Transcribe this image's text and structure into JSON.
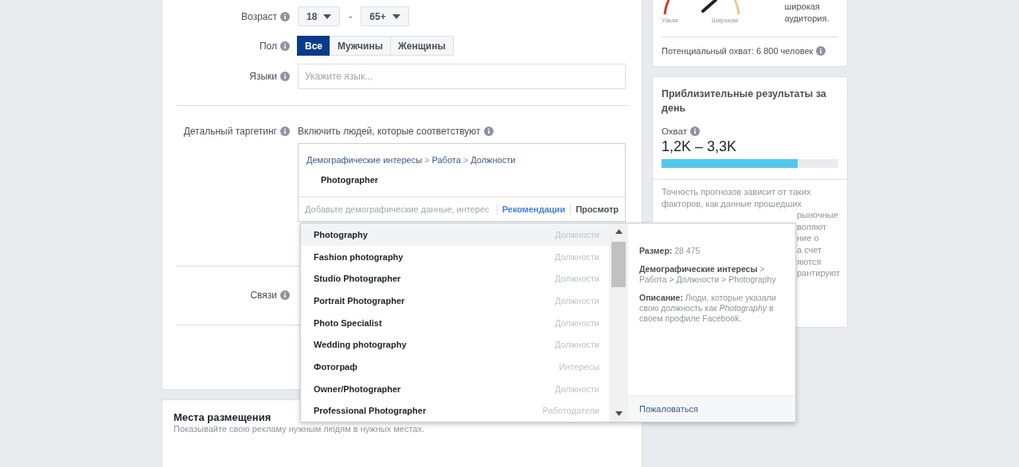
{
  "age": {
    "label": "Возраст",
    "from": "18",
    "separator": "-",
    "to": "65+"
  },
  "gender": {
    "label": "Пол",
    "options": [
      {
        "label": "Все",
        "selected": true
      },
      {
        "label": "Мужчины",
        "selected": false
      },
      {
        "label": "Женщины",
        "selected": false
      }
    ]
  },
  "languages": {
    "label": "Языки",
    "placeholder": "Укажите язык..."
  },
  "detailed_targeting": {
    "label": "Детальный таргетинг",
    "include_text": "Включить людей, которые соответствуют",
    "breadcrumb": [
      "Демографические интересы",
      "Работа",
      "Должности"
    ],
    "separator": ">",
    "selected_item": "Photographer",
    "search_placeholder": "Добавьте демографические данные, интерес",
    "suggestions_link": "Рекомендации",
    "browse_link": "Просмотр"
  },
  "connections": {
    "label": "Связи"
  },
  "placements": {
    "title": "Места размещения",
    "subtitle": "Показывайте свою рекламу нужным людям в нужных местах."
  },
  "dropdown": {
    "items": [
      {
        "name": "Photography",
        "category": "Должности",
        "selected": true
      },
      {
        "name": "Fashion photography",
        "category": "Должности",
        "selected": false
      },
      {
        "name": "Studio Photographer",
        "category": "Должности",
        "selected": false
      },
      {
        "name": "Portrait Photographer",
        "category": "Должности",
        "selected": false
      },
      {
        "name": "Photo Specialist",
        "category": "Должности",
        "selected": false
      },
      {
        "name": "Wedding photography",
        "category": "Должности",
        "selected": false
      },
      {
        "name": "Фотограф",
        "category": "Интересы",
        "selected": false
      },
      {
        "name": "Owner/Photographer",
        "category": "Должности",
        "selected": false
      },
      {
        "name": "Professional Photographer",
        "category": "Работодатели",
        "selected": false
      }
    ],
    "detail": {
      "size": "**Размер:** 28 475",
      "path": "**Демографические интересы** > Работа > Должности > Photography",
      "description": "**Описание:** Люди, которые указали свою должность как *Photography* в своем профиле Facebook.",
      "report_link": "Пожаловаться"
    }
  },
  "audience": {
    "narrow_label": "Узкая",
    "wide_label": "Широкая",
    "verdict": "широкая аудитория.",
    "potential_reach": "Потенциальный охват: 6 800 человек"
  },
  "estimates": {
    "title": "Приблизительные результаты за день",
    "metric_label": "Охват",
    "metric_value": "1,2K – 3,3K",
    "level": 0.77,
    "note_lines": [
      "Точность прогнозов зависит от таких",
      "факторов, как данные прошедших"
    ],
    "note_fragments": [
      "рыночные",
      "воляют",
      "ние о",
      "а счет",
      "яются",
      "рантируют"
    ]
  }
}
